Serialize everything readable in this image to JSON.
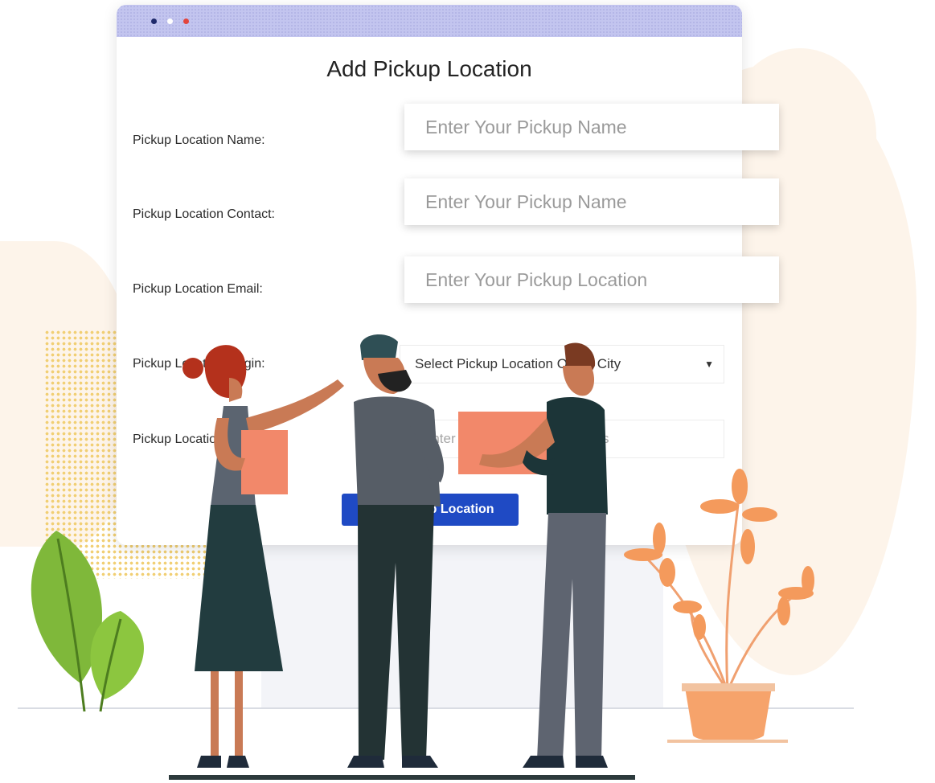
{
  "form": {
    "title": "Add Pickup Location",
    "fields": [
      {
        "label": "Pickup Location Name:",
        "placeholder": "Enter Your Pickup Name"
      },
      {
        "label": "Pickup Location Contact:",
        "placeholder": "Enter Your Pickup Name"
      },
      {
        "label": "Pickup Location Email:",
        "placeholder": "Enter Your Pickup Location"
      },
      {
        "label": "Pickup Location Origin:",
        "value": "Select Pickup Location Origin City"
      },
      {
        "label": "Pickup Location Address:",
        "placeholder": "Enter Pickup Location Address"
      }
    ],
    "submit_label": "Add Pickup Location"
  },
  "colors": {
    "accent": "#1f4ac4",
    "titlebar": "#c3c5ef",
    "background_blob": "#fdf4ea",
    "folder": "#f2886a"
  },
  "icons": {
    "window_controls": [
      "window-dot-navy",
      "window-dot-white",
      "window-dot-red"
    ],
    "select_caret": "caret-down-icon"
  }
}
